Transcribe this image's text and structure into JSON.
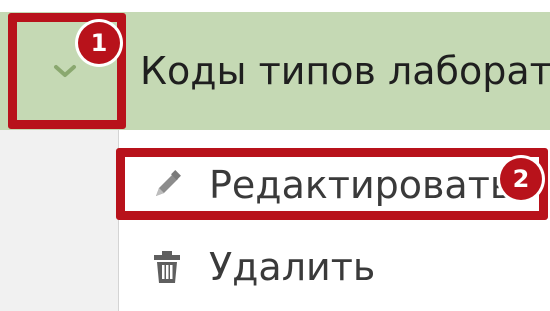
{
  "header": {
    "title": "Коды типов лаборат"
  },
  "menu": {
    "items": [
      {
        "label": "Редактировать",
        "icon": "pencil-icon"
      },
      {
        "label": "Удалить",
        "icon": "trash-icon"
      }
    ]
  },
  "annotations": {
    "badge_1": "1",
    "badge_2": "2",
    "color": "#b8121b"
  },
  "colors": {
    "header_bg": "#c5d9b4",
    "chevron": "#8aa86f"
  }
}
